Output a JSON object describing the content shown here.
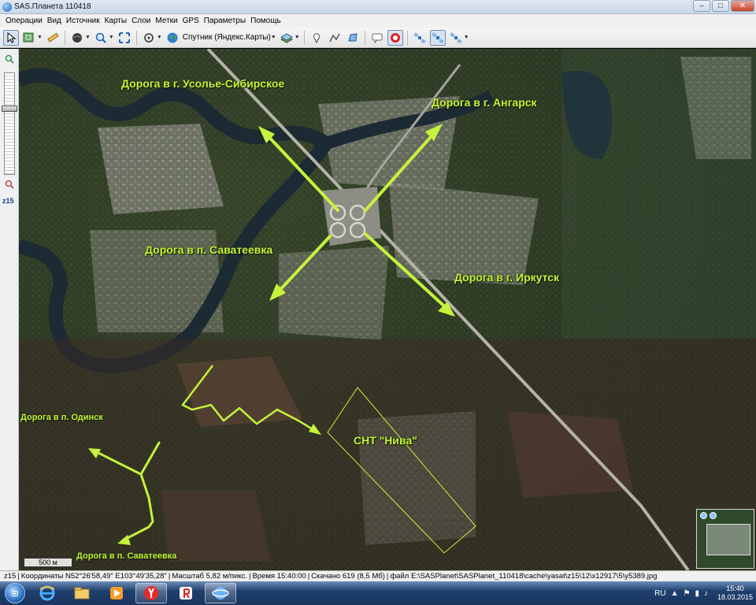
{
  "window": {
    "title": "SAS.Планета 110418",
    "minimize_glyph": "–",
    "maximize_glyph": "□",
    "close_glyph": "✕"
  },
  "menu": {
    "items": [
      "Операции",
      "Вид",
      "Источник",
      "Карты",
      "Слои",
      "Метки",
      "GPS",
      "Параметры",
      "Помощь"
    ]
  },
  "toolbar": {
    "map_source_label": "Спутник (Яндекс.Карты)",
    "icons": [
      "pointer-icon",
      "map-select-icon",
      "ruler-icon",
      "globe-icon",
      "zoom-icon",
      "fullscreen-icon",
      "gps-icon",
      "earth-icon",
      "layers-icon",
      "placemark-icon",
      "path-icon",
      "polygon-icon",
      "bubble-icon",
      "stop-icon",
      "satellite-icon",
      "satellite-active-icon",
      "satellite-settings-icon"
    ]
  },
  "zoom_panel": {
    "level": "z15"
  },
  "map": {
    "labels": {
      "usolye": "Дорога в г. Усолье-Сибирское",
      "angarsk": "Дорога в г. Ангарск",
      "savateevka_top": "Дорога в п. Саватеевка",
      "irkutsk": "Дорога в г. Иркутск",
      "odinsk": "Дорога в п. Одинск",
      "niva": "СНТ \"Нива\"",
      "savateevka_bottom": "Дорога в п. Саватеевка"
    },
    "scale": "500 м",
    "accent_color": "#c5f23c"
  },
  "statusbar": {
    "zoom": "z15",
    "coords": "Координаты N52°26'58,49\" E103°49'35,28\"",
    "scale": "Масштаб 5,82 м/пикс.",
    "time": "Время 15:40:00",
    "downloaded": "Скачано 619 (8,5 Мб)",
    "file": "файл E:\\SASPlanet\\SASPlanet_110418\\cache\\yasat\\z15\\12\\x12917\\5\\y5389.jpg"
  },
  "taskbar": {
    "apps": [
      "ie-icon",
      "explorer-icon",
      "media-icon",
      "yandex-icon",
      "yandex-browser-icon",
      "sasplanet-icon"
    ],
    "language": "RU",
    "time": "15:40",
    "date": "18.03.2015"
  }
}
